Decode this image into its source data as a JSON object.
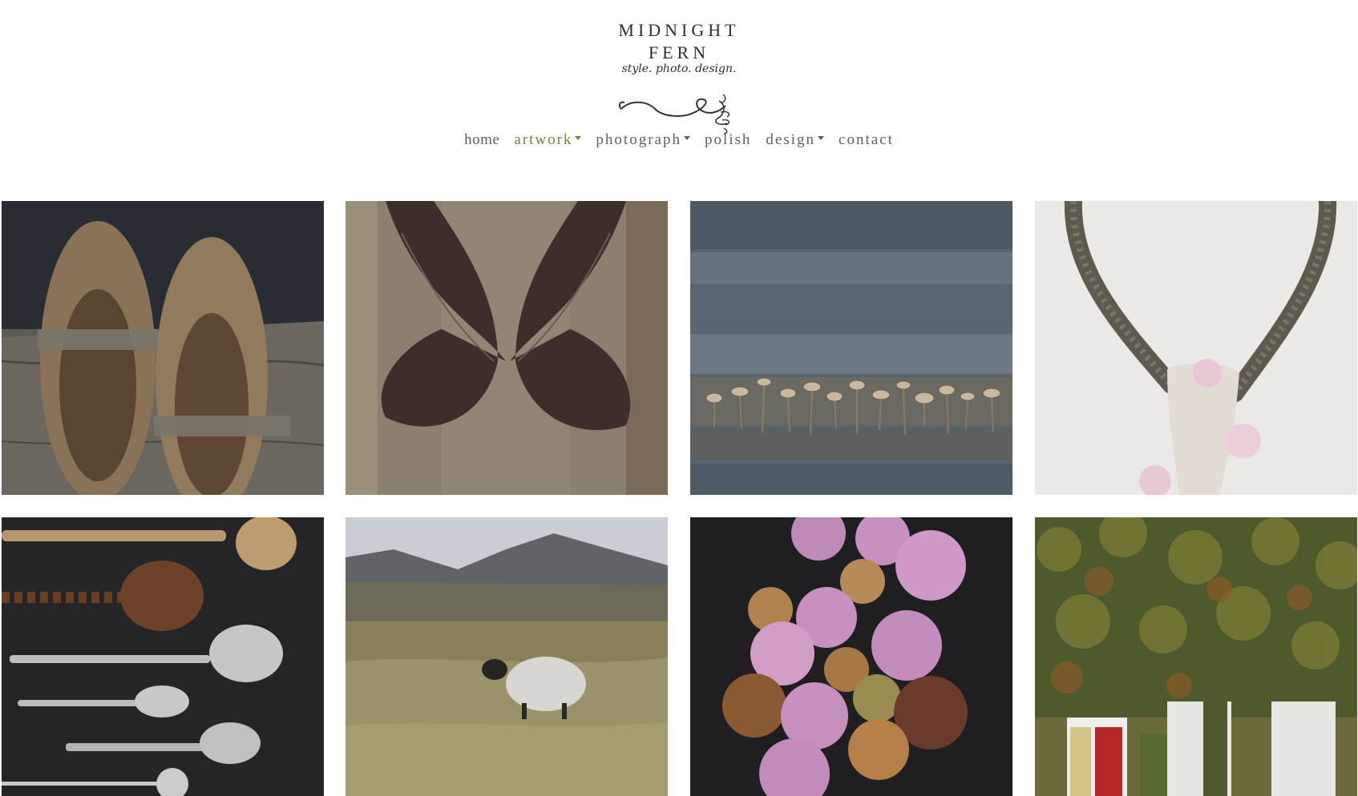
{
  "logo": {
    "title": "MIDNIGHT FERN",
    "tagline": "style. photo. design."
  },
  "nav": {
    "items": [
      {
        "label": "home",
        "has_dropdown": false,
        "active": false
      },
      {
        "label": "artwork",
        "has_dropdown": true,
        "active": true
      },
      {
        "label": "photograph",
        "has_dropdown": true,
        "active": false
      },
      {
        "label": "polish",
        "has_dropdown": false,
        "active": false
      },
      {
        "label": "design",
        "has_dropdown": true,
        "active": false
      },
      {
        "label": "contact",
        "has_dropdown": false,
        "active": false
      }
    ],
    "active_color": "#6a8a3a",
    "text_color": "#5f5f5f"
  },
  "gallery": {
    "images": [
      {
        "subject": "wooden clogs"
      },
      {
        "subject": "feather wings"
      },
      {
        "subject": "row of mushrooms on wood"
      },
      {
        "subject": "antelope horns with magnolia"
      },
      {
        "subject": "antique spoons"
      },
      {
        "subject": "sheep in mountain landscape"
      },
      {
        "subject": "pink ranunculus flowers"
      },
      {
        "subject": "ivy covered house"
      }
    ]
  }
}
